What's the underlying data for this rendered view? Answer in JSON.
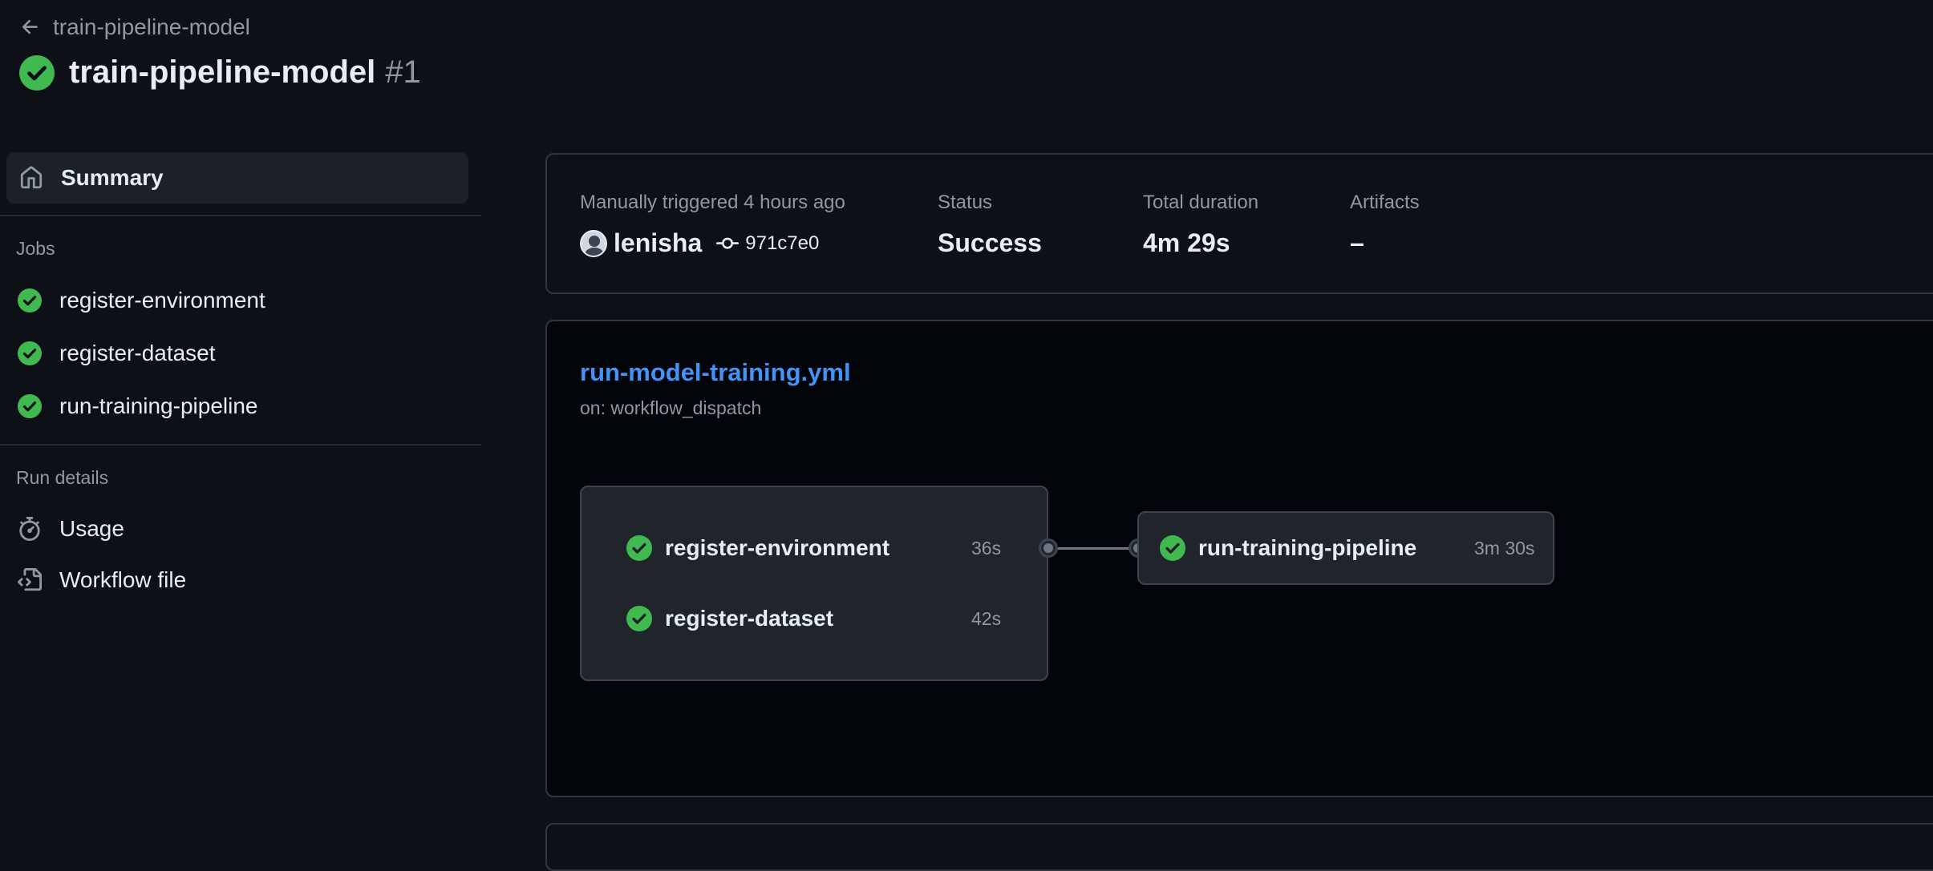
{
  "header": {
    "back_label": "train-pipeline-model",
    "title": "train-pipeline-model",
    "run_number": "#1",
    "status_icon": "check-circle-fill-icon"
  },
  "sidebar": {
    "summary_label": "Summary",
    "jobs_heading": "Jobs",
    "jobs": [
      {
        "label": "register-environment",
        "status": "success"
      },
      {
        "label": "register-dataset",
        "status": "success"
      },
      {
        "label": "run-training-pipeline",
        "status": "success"
      }
    ],
    "run_details_heading": "Run details",
    "details": [
      {
        "label": "Usage",
        "icon": "stopwatch-icon"
      },
      {
        "label": "Workflow file",
        "icon": "file-code-icon"
      }
    ]
  },
  "summary": {
    "trigger_label": "Manually triggered 4 hours ago",
    "user": "lenisha",
    "commit": "971c7e0",
    "status_label": "Status",
    "status_value": "Success",
    "duration_label": "Total duration",
    "duration_value": "4m 29s",
    "artifacts_label": "Artifacts",
    "artifacts_value": "–"
  },
  "workflow": {
    "file": "run-model-training.yml",
    "trigger": "on: workflow_dispatch",
    "group_jobs": [
      {
        "name": "register-environment",
        "duration": "36s"
      },
      {
        "name": "register-dataset",
        "duration": "42s"
      }
    ],
    "downstream_job": {
      "name": "run-training-pipeline",
      "duration": "3m 30s"
    }
  },
  "colors": {
    "background": "#0d1117",
    "success": "#3fb950",
    "link": "#4493f8",
    "muted": "#9198a1"
  }
}
